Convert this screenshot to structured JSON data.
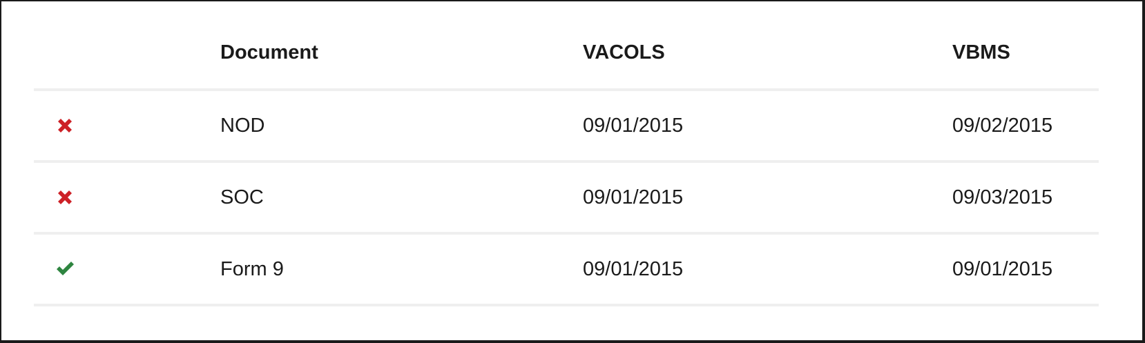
{
  "table": {
    "columns": [
      "",
      "Document",
      "VACOLS",
      "VBMS"
    ],
    "rows": [
      {
        "status": "mismatch",
        "status_icon": "x-icon",
        "status_color": "#cd2026",
        "document": "NOD",
        "vacols": "09/01/2015",
        "vbms": "09/02/2015"
      },
      {
        "status": "mismatch",
        "status_icon": "x-icon",
        "status_color": "#cd2026",
        "document": "SOC",
        "vacols": "09/01/2015",
        "vbms": "09/03/2015"
      },
      {
        "status": "match",
        "status_icon": "checkmark-icon",
        "status_color": "#2e8540",
        "document": "Form 9",
        "vacols": "09/01/2015",
        "vbms": "09/01/2015"
      }
    ]
  }
}
